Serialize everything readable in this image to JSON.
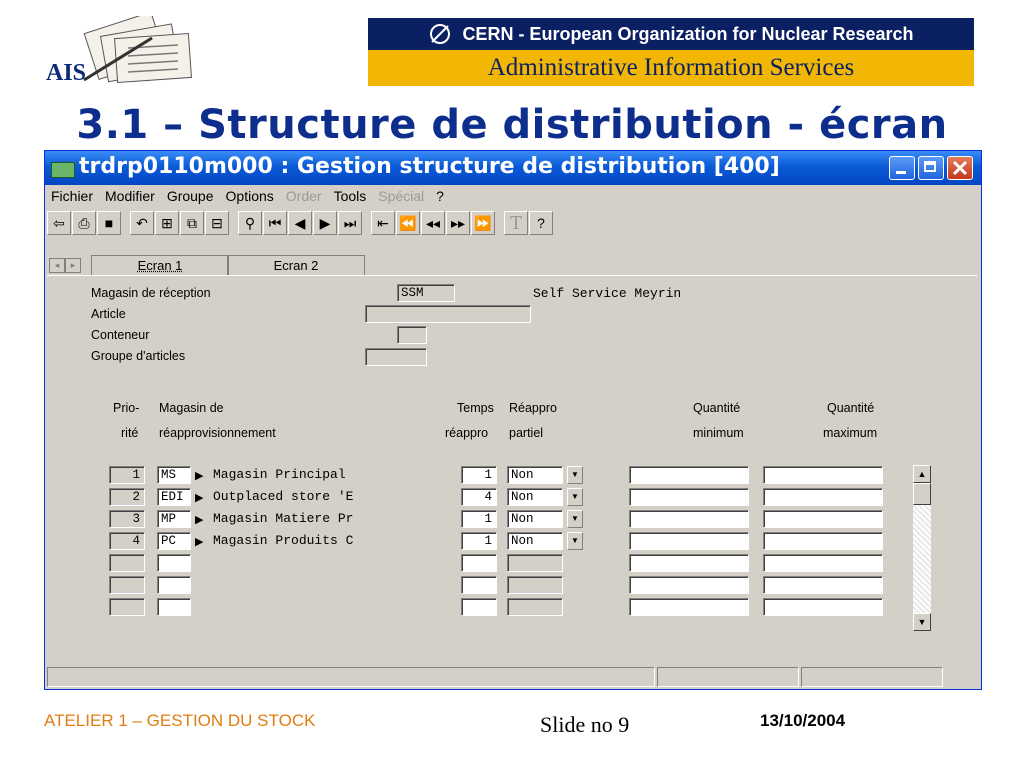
{
  "header": {
    "logo_text": "AIS",
    "org_name": "CERN - European Organization for Nuclear Research",
    "service_name": "Administrative Information Services"
  },
  "slide": {
    "title": "3.1 – Structure de distribution - écran",
    "footer_left": "ATELIER 1 – GESTION DU STOCK",
    "footer_center": "Slide no 9",
    "footer_right": "13/10/2004"
  },
  "window": {
    "title": "trdrp0110m000 : Gestion structure de distribution [400]",
    "menu": [
      "Fichier",
      "Modifier",
      "Groupe",
      "Options",
      "Order",
      "Tools",
      "Spécial",
      "?"
    ],
    "menu_disabled": [
      "Order",
      "Spécial"
    ],
    "tabs": [
      "Ecran 1",
      "Ecran 2"
    ],
    "active_tab": "Ecran 1"
  },
  "form": {
    "fields": [
      {
        "label": "Magasin de réception",
        "value": "SSM",
        "description": "Self Service Meyrin"
      },
      {
        "label": "Article",
        "value": ""
      },
      {
        "label": "Conteneur",
        "value": ""
      },
      {
        "label": "Groupe d'articles",
        "value": ""
      }
    ],
    "columns": {
      "prio_1": "Prio-",
      "prio_2": "rité",
      "mag_1": "Magasin de",
      "mag_2": "réapprovisionnement",
      "temps_1": "Temps",
      "temps_2": "réappro",
      "reappro_1": "Réappro",
      "reappro_2": "partiel",
      "qmin_1": "Quantité",
      "qmin_2": "minimum",
      "qmax_1": "Quantité",
      "qmax_2": "maximum"
    },
    "rows": [
      {
        "prio": "1",
        "code": "MS",
        "name": "Magasin Principal",
        "temps": "1",
        "partiel": "Non",
        "qmin": "",
        "qmax": ""
      },
      {
        "prio": "2",
        "code": "EDI",
        "name": "Outplaced store 'E",
        "temps": "4",
        "partiel": "Non",
        "qmin": "",
        "qmax": ""
      },
      {
        "prio": "3",
        "code": "MP",
        "name": "Magasin Matiere Pr",
        "temps": "1",
        "partiel": "Non",
        "qmin": "",
        "qmax": ""
      },
      {
        "prio": "4",
        "code": "PC",
        "name": "Magasin Produits C",
        "temps": "1",
        "partiel": "Non",
        "qmin": "",
        "qmax": ""
      },
      {
        "prio": "",
        "code": "",
        "name": "",
        "temps": "",
        "partiel": "",
        "qmin": "",
        "qmax": ""
      },
      {
        "prio": "",
        "code": "",
        "name": "",
        "temps": "",
        "partiel": "",
        "qmin": "",
        "qmax": ""
      },
      {
        "prio": "",
        "code": "",
        "name": "",
        "temps": "",
        "partiel": "",
        "qmin": "",
        "qmax": ""
      }
    ]
  },
  "toolbar_icons": [
    "exit-icon",
    "print-icon",
    "save-icon",
    "undo-icon",
    "duplicate-icon",
    "copy-icon",
    "insert-icon",
    "find-icon",
    "first-record-icon",
    "previous-record-icon",
    "next-record-icon",
    "last-record-icon",
    "first-set-icon",
    "first-page-icon",
    "previous-page-icon",
    "next-page-icon",
    "last-page-icon",
    "text-icon",
    "help-icon"
  ]
}
